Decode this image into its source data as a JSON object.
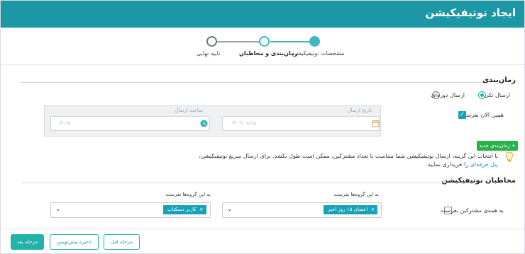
{
  "header": {
    "title": "ایجاد نوتیفیکیشن"
  },
  "stepper": {
    "steps": [
      {
        "label": "مشخصات نوتیفیکیشن",
        "state": "done"
      },
      {
        "label": "زمان‌بندی و مخاطبان",
        "state": "current"
      },
      {
        "label": "تایید نهایی",
        "state": "pending"
      }
    ]
  },
  "scheduling": {
    "title": "زمان‌بندی",
    "radio_single": "ارسال تکی",
    "radio_periodic": "ارسال دوره‌ای",
    "send_now_label": "همین الان بفرست",
    "date_label": "تاریخ ارسال",
    "date_value": "۱۴۰۲/۰۸/۱۵",
    "time_label": "ساعت ارسال",
    "time_value": "۱۴:۱۵",
    "new_schedule_button": "+ زمان‌بندی جدید",
    "info_text_1": "با انتخاب این گزینه، ارسال نوتیفیکیشن شما متناسب با تعداد مشترکین، ممکن است طول بکشد. برای ارسال سریع نوتیفیکیشن،",
    "info_link": "پنل حرفه‌ای",
    "info_text_2": "را خریداری نمایید."
  },
  "audience": {
    "title": "مخاطبان نوتیفیکیشن",
    "send_to_groups_label": "به این گروه‌ها بفرست",
    "send_to_groups_tag": "اعضای ۱۵ روز اخیر",
    "dont_send_label": "به این گروه‌ها نفرست",
    "dont_send_tag": "کاربر دسکتاپ",
    "all_subscribers_label": "به همه‌ی مشترکین بفرست"
  },
  "footer": {
    "next_button": "مرحله بعد",
    "draft_button": "ذخیره پیش‌نویس",
    "prev_button": "مرحله قبل"
  },
  "colors": {
    "header": "#1b97a6",
    "accent": "#22b2a8",
    "green": "#27b34a"
  }
}
